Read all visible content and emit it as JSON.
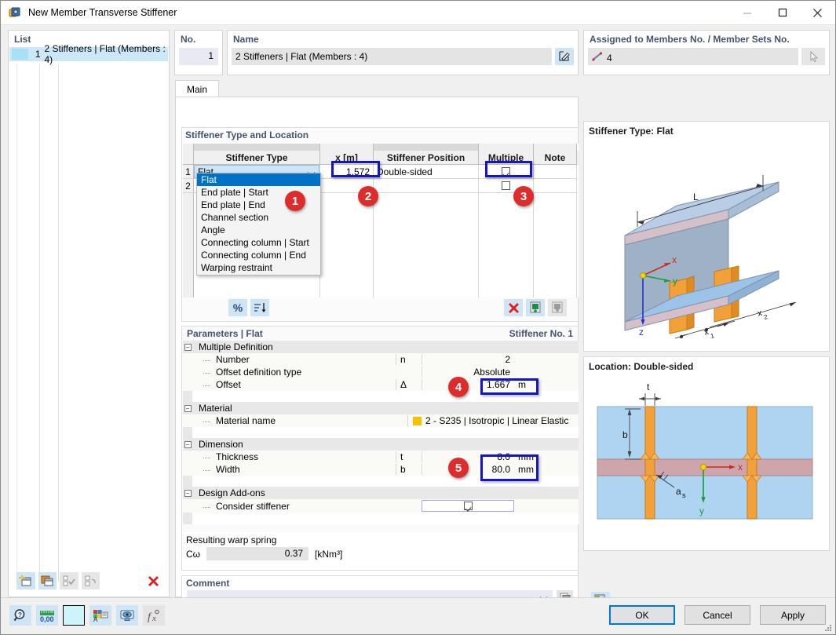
{
  "window": {
    "title": "New Member Transverse Stiffener",
    "icon": "stiffener-app-icon",
    "minimize": "minimize-icon",
    "maximize": "maximize-icon",
    "close": "close-icon"
  },
  "list_panel": {
    "header": "List",
    "rows": [
      {
        "index": "1",
        "label": "2 Stiffeners | Flat (Members : 4)"
      }
    ],
    "toolbar": [
      {
        "name": "new-item-button",
        "icon": "new-window-icon",
        "enabled": true
      },
      {
        "name": "copy-item-button",
        "icon": "copy-windows-icon",
        "enabled": true
      },
      {
        "name": "select-all-button",
        "icon": "check-all-icon",
        "enabled": false
      },
      {
        "name": "invert-selection-button",
        "icon": "invert-check-icon",
        "enabled": false
      },
      {
        "name": "delete-item-button",
        "icon": "red-x-icon",
        "enabled": true
      }
    ]
  },
  "no_panel": {
    "header": "No.",
    "value": "1"
  },
  "name_panel": {
    "header": "Name",
    "value": "2 Stiffeners | Flat (Members : 4)",
    "edit_icon": "edit-pencil-icon"
  },
  "assigned_panel": {
    "header": "Assigned to Members No. / Member Sets No.",
    "value": "4",
    "member_icon": "member-line-icon",
    "pick_icon": "pick-cursor-icon"
  },
  "tabs": [
    {
      "label": "Main",
      "active": true
    }
  ],
  "stiffener_group": {
    "title": "Stiffener Type and Location",
    "columns": [
      "",
      "Stiffener Type",
      "x [m]",
      "Stiffener Position",
      "Multiple",
      "Note"
    ],
    "rows": [
      {
        "index": "1",
        "type": "Flat",
        "x": "1.572",
        "position": "Double-sided",
        "multiple": true,
        "note": ""
      },
      {
        "index": "2",
        "type": "",
        "x": "",
        "position": "",
        "multiple": false,
        "note": ""
      }
    ],
    "dropdown": {
      "open": true,
      "selected": "Flat",
      "options": [
        "Flat",
        "End plate | Start",
        "End plate | End",
        "Channel section",
        "Angle",
        "Connecting column | Start",
        "Connecting column | End",
        "Warping restraint"
      ]
    },
    "toolbar": [
      {
        "name": "percent-button",
        "icon": "percent-icon",
        "label": "%"
      },
      {
        "name": "sort-button",
        "icon": "sort-descending-icon"
      },
      {
        "name": "delete-row-button",
        "icon": "red-x-icon"
      },
      {
        "name": "import-excel-button",
        "icon": "excel-import-icon"
      },
      {
        "name": "export-excel-button",
        "icon": "excel-export-icon"
      }
    ]
  },
  "parameters": {
    "title_left": "Parameters | Flat",
    "title_right": "Stiffener No. 1",
    "sections": [
      {
        "name": "Multiple Definition",
        "rows": [
          {
            "label": "Number",
            "symbol": "n",
            "value": "2",
            "unit": ""
          },
          {
            "label": "Offset definition type",
            "symbol": "",
            "value": "Absolute",
            "unit": ""
          },
          {
            "label": "Offset",
            "symbol": "Δ",
            "value": "1.667",
            "unit": "m"
          }
        ]
      },
      {
        "name": "Material",
        "rows": [
          {
            "label": "Material name",
            "symbol": "",
            "value": "2 - S235 | Isotropic | Linear Elastic",
            "unit": "",
            "swatch": "#f5c100"
          }
        ]
      },
      {
        "name": "Dimension",
        "rows": [
          {
            "label": "Thickness",
            "symbol": "t",
            "value": "8.0",
            "unit": "mm"
          },
          {
            "label": "Width",
            "symbol": "b",
            "value": "80.0",
            "unit": "mm"
          }
        ]
      },
      {
        "name": "Design Add-ons",
        "rows": [
          {
            "label": "Consider stiffener",
            "symbol": "",
            "value": "",
            "unit": "",
            "checkbox": true
          }
        ]
      }
    ]
  },
  "warp_spring": {
    "label": "Resulting warp spring",
    "symbol": "Cω",
    "value": "0.37",
    "unit": "[kNm³]"
  },
  "comment": {
    "label": "Comment",
    "value": "",
    "dropdown_icon": "chevron-down-icon",
    "pick_icon": "comment-copy-icon"
  },
  "graphics": {
    "top_caption": "Stiffener Type: Flat",
    "bottom_caption": "Location: Double-sided",
    "top_labels": [
      "L",
      "x",
      "y",
      "z",
      "x₁",
      "x₂"
    ],
    "bottom_labels": [
      "t",
      "b",
      "a",
      "x",
      "y"
    ],
    "comment_button_icon": "image-comment-icon"
  },
  "bottom_toolbar": [
    {
      "name": "help-button",
      "icon": "help-magnifier-icon",
      "enabled": true
    },
    {
      "name": "units-button",
      "icon": "units-000-icon",
      "enabled": true
    },
    {
      "name": "color-button",
      "icon": "color-swatch-icon",
      "enabled": true
    },
    {
      "name": "display-properties-button",
      "icon": "display-props-icon",
      "enabled": true
    },
    {
      "name": "visibility-button",
      "icon": "visibility-monitor-icon",
      "enabled": true
    },
    {
      "name": "formula-button",
      "icon": "fx-formula-icon",
      "enabled": false
    }
  ],
  "dialog_buttons": {
    "ok": "OK",
    "cancel": "Cancel",
    "apply": "Apply"
  },
  "badges": [
    "1",
    "2",
    "3",
    "4",
    "5"
  ],
  "colors": {
    "accent": "#0078d7",
    "highlight_box": "#1515c8",
    "badge": "#dd2c2c",
    "group_label": "#44546a",
    "selection": "#0072c6"
  }
}
